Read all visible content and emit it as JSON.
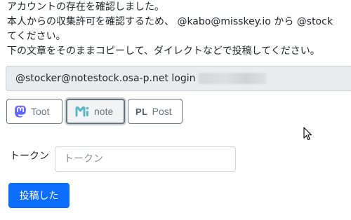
{
  "instructions": {
    "line1": "アカウントの存在を確認しました。",
    "line2": "本人からの収集許可を確認するため、 @kabo@misskey.io から @stock",
    "line3": "てください。",
    "line4": "下の文章をそのままコピーして、ダイレクトなどで投稿してください。"
  },
  "command": {
    "text": "@stocker@notestock.osa-p.net login"
  },
  "share_buttons": {
    "toot": {
      "label": "Toot",
      "icon": "mastodon-icon",
      "color": "#6364ff"
    },
    "note": {
      "label": "note",
      "icon": "misskey-icon",
      "color": "#5fb4c9"
    },
    "post": {
      "label": "Post",
      "icon": "PL"
    }
  },
  "token": {
    "label": "トークン",
    "placeholder": "トークン",
    "value": ""
  },
  "submit": {
    "label": "投稿した",
    "color": "#0d6efd"
  }
}
